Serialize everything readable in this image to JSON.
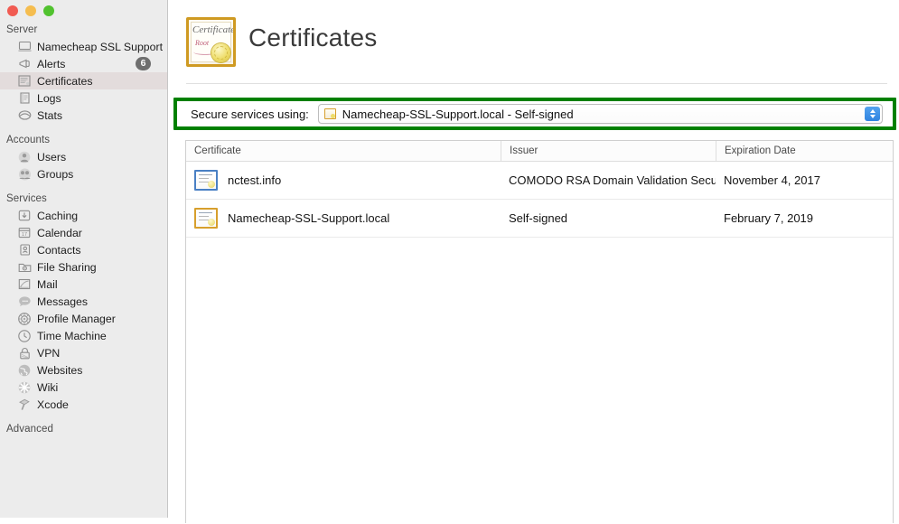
{
  "window": {
    "traffic_lights": [
      "close",
      "minimize",
      "zoom"
    ],
    "accent_green": "#008000",
    "accent_blue": "#2f83e0"
  },
  "sidebar": {
    "groups": [
      {
        "title": "Server",
        "items": [
          {
            "label": "Namecheap SSL Support",
            "icon": "server-computer-icon",
            "selected": false,
            "badge": ""
          },
          {
            "label": "Alerts",
            "icon": "megaphone-icon",
            "selected": false,
            "badge": "6"
          },
          {
            "label": "Certificates",
            "icon": "certificate-document-icon",
            "selected": true,
            "badge": ""
          },
          {
            "label": "Logs",
            "icon": "log-document-icon",
            "selected": false,
            "badge": ""
          },
          {
            "label": "Stats",
            "icon": "stats-gauge-icon",
            "selected": false,
            "badge": ""
          }
        ]
      },
      {
        "title": "Accounts",
        "items": [
          {
            "label": "Users",
            "icon": "user-icon",
            "selected": false,
            "badge": ""
          },
          {
            "label": "Groups",
            "icon": "group-icon",
            "selected": false,
            "badge": ""
          }
        ]
      },
      {
        "title": "Services",
        "items": [
          {
            "label": "Caching",
            "icon": "download-box-icon",
            "selected": false,
            "badge": ""
          },
          {
            "label": "Calendar",
            "icon": "calendar-icon",
            "selected": false,
            "badge": ""
          },
          {
            "label": "Contacts",
            "icon": "contacts-book-icon",
            "selected": false,
            "badge": ""
          },
          {
            "label": "File Sharing",
            "icon": "folder-share-icon",
            "selected": false,
            "badge": ""
          },
          {
            "label": "Mail",
            "icon": "mail-stamp-icon",
            "selected": false,
            "badge": ""
          },
          {
            "label": "Messages",
            "icon": "speech-bubble-icon",
            "selected": false,
            "badge": ""
          },
          {
            "label": "Profile Manager",
            "icon": "gear-circle-icon",
            "selected": false,
            "badge": ""
          },
          {
            "label": "Time Machine",
            "icon": "clock-icon",
            "selected": false,
            "badge": ""
          },
          {
            "label": "VPN",
            "icon": "padlock-icon",
            "selected": false,
            "badge": ""
          },
          {
            "label": "Websites",
            "icon": "globe-icon",
            "selected": false,
            "badge": ""
          },
          {
            "label": "Wiki",
            "icon": "pinwheel-icon",
            "selected": false,
            "badge": ""
          },
          {
            "label": "Xcode",
            "icon": "hammer-icon",
            "selected": false,
            "badge": ""
          }
        ]
      },
      {
        "title": "Advanced",
        "items": []
      }
    ]
  },
  "header": {
    "title": "Certificates",
    "icon": "certificate-seal-icon",
    "icon_text_main": "Certificate",
    "icon_text_sub": "Root"
  },
  "secure_services": {
    "label": "Secure services using:",
    "selected_value": "Namecheap-SSL-Support.local - Self-signed",
    "popup_icon": "certificate-small-icon",
    "stepper_icon": "up-down-chevron-icon"
  },
  "table": {
    "columns": [
      "Certificate",
      "Issuer",
      "Expiration Date"
    ],
    "rows": [
      {
        "icon": "certificate-blue-icon",
        "certificate": "nctest.info",
        "issuer": "COMODO RSA Domain Validation Secu...",
        "expiration": "November 4, 2017"
      },
      {
        "icon": "certificate-gold-icon",
        "certificate": "Namecheap-SSL-Support.local",
        "issuer": "Self-signed",
        "expiration": "February 7, 2019"
      }
    ]
  }
}
